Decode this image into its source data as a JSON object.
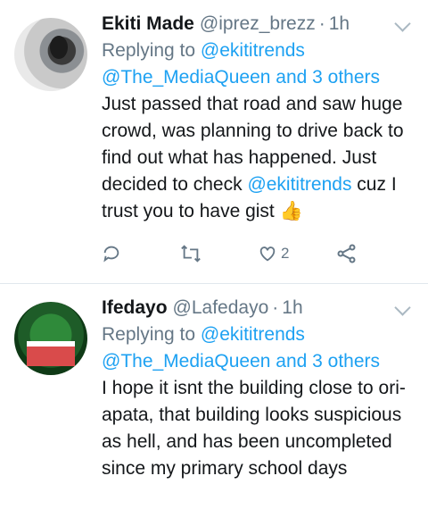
{
  "tweets": [
    {
      "name": "Ekiti Made",
      "handle": "@iprez_brezz",
      "dot": "·",
      "time": "1h",
      "reply_prefix": "Replying to",
      "reply_user": "@ekititrends",
      "reply_others": "@The_MediaQueen and 3 others",
      "text_before": "Just passed that road and saw huge crowd, was planning to drive back to find out what has happened. Just decided to check ",
      "text_mention": "@ekititrends",
      "text_after": " cuz I trust you to have gist",
      "emoji": "👍",
      "like_count": "2"
    },
    {
      "name": "Ifedayo",
      "handle": "@Lafedayo",
      "dot": "·",
      "time": "1h",
      "reply_prefix": "Replying to",
      "reply_user": "@ekititrends",
      "reply_others": "@The_MediaQueen and 3 others",
      "text": "I hope it isnt the building close to ori-apata, that building looks suspicious as hell, and has been uncompleted since my primary school days"
    }
  ],
  "icons": [
    "reply-icon",
    "retweet-icon",
    "like-icon",
    "share-icon",
    "chevron-down-icon"
  ],
  "colors": {
    "link": "#1da1f2",
    "muted": "#657786",
    "text": "#14171a"
  }
}
